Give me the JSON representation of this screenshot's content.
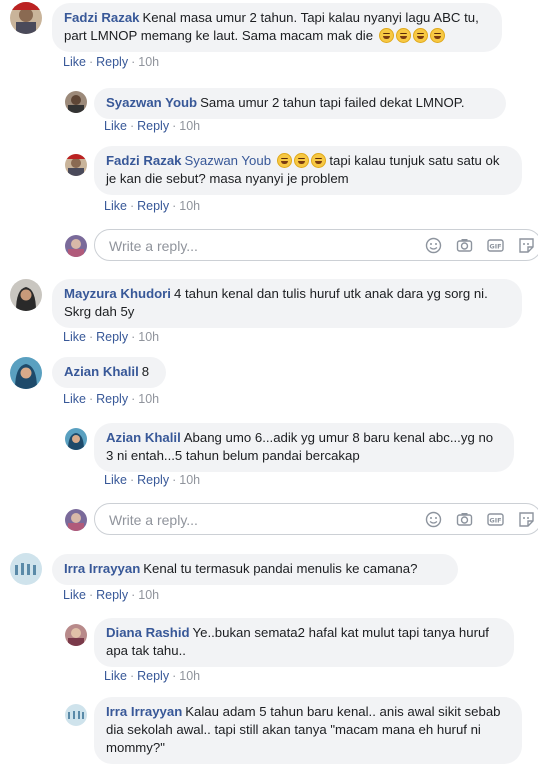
{
  "comments": [
    {
      "name": "Fadzi Razak",
      "text": "Kenal masa umur 2 tahun. Tapi kalau nyanyi lagu ABC tu, part LMNOP memang ke laut. Sama macam mak die",
      "like": "Like",
      "reply": "Reply",
      "time": "10h"
    },
    {
      "name": "Syazwan Youb",
      "text": "Sama umur 2 tahun tapi failed dekat LMNOP.",
      "like": "Like",
      "reply": "Reply",
      "time": "10h"
    },
    {
      "name": "Fadzi Razak",
      "mention": "Syazwan Youb",
      "text": "tapi kalau tunjuk satu satu ok je kan die sebut? masa nyanyi je problem",
      "like": "Like",
      "reply": "Reply",
      "time": "10h"
    },
    {
      "name": "Mayzura Khudori",
      "text": "4 tahun kenal dan tulis huruf utk anak dara yg sorg ni. Skrg dah 5y",
      "like": "Like",
      "reply": "Reply",
      "time": "10h"
    },
    {
      "name": "Azian Khalil",
      "text": "8",
      "like": "Like",
      "reply": "Reply",
      "time": "10h"
    },
    {
      "name": "Azian Khalil",
      "text": "Abang umo 6...adik yg umur 8 baru kenal abc...yg no 3 ni entah...5 tahun belum pandai bercakap",
      "like": "Like",
      "reply": "Reply",
      "time": "10h"
    },
    {
      "name": "Irra Irrayyan",
      "text": "Kenal tu termasuk pandai menulis ke camana?",
      "like": "Like",
      "reply": "Reply",
      "time": "10h"
    },
    {
      "name": "Diana Rashid",
      "text": "Ye..bukan semata2 hafal kat mulut tapi tanya huruf apa tak tahu..",
      "like": "Like",
      "reply": "Reply",
      "time": "10h"
    },
    {
      "name": "Irra Irrayyan",
      "text": "Kalau adam 5 tahun baru kenal.. anis awal sikit sebab dia sekolah awal.. tapi still akan tanya \"macam mana eh huruf ni mommy?\""
    }
  ],
  "reply_box": {
    "placeholder": "Write a reply..."
  },
  "icons": [
    "emoji-icon",
    "camera-icon",
    "gif-icon",
    "sticker-icon"
  ],
  "colors": {
    "link": "#385898",
    "bubble": "#f2f3f5",
    "meta": "#90949c"
  }
}
